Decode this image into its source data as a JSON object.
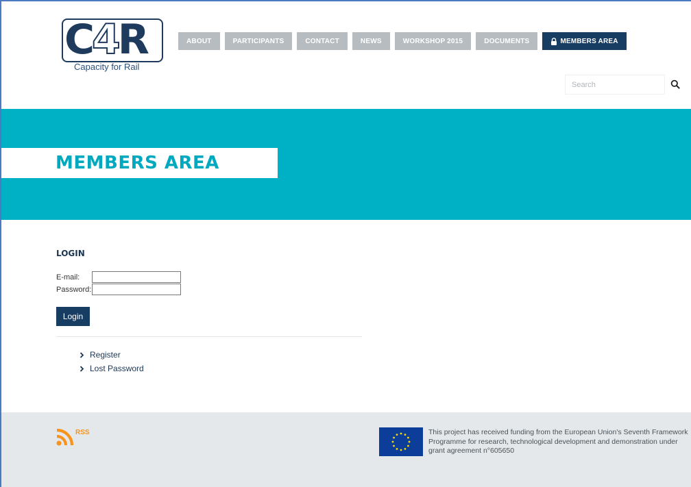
{
  "header": {
    "logo": {
      "letters": {
        "c": "C",
        "four": "4",
        "r": "R"
      },
      "tagline": "Capacity for Rail"
    },
    "nav": [
      {
        "label": "ABOUT"
      },
      {
        "label": "PARTICIPANTS"
      },
      {
        "label": "CONTACT"
      },
      {
        "label": "NEWS"
      },
      {
        "label": "WORKSHOP 2015"
      },
      {
        "label": "DOCUMENTS"
      },
      {
        "label": "MEMBERS AREA",
        "icon": "lock-icon",
        "active": true
      }
    ],
    "search": {
      "placeholder": "Search",
      "value": "",
      "icon": "search-icon"
    }
  },
  "banner": {
    "title": "MEMBERS AREA"
  },
  "login": {
    "title": "LOGIN",
    "email_label": "E-mail:",
    "email_value": "",
    "password_label": "Password:",
    "password_value": "",
    "button_label": "Login",
    "links": [
      {
        "label": "Register",
        "icon": "chevron-right-icon"
      },
      {
        "label": "Lost Password",
        "icon": "chevron-right-icon"
      }
    ]
  },
  "footer": {
    "rss_label": "RSS",
    "rss_icon": "rss-icon",
    "flag_icon": "eu-flag-icon",
    "funding_text": "This project has received funding from the European Union's Seventh Framework Programme for research, technological development and demonstration under grant agreement n°605650"
  },
  "colors": {
    "accent": "#00b0c4",
    "navy": "#173d63",
    "nav_inactive": "#b7bcc0",
    "footer_bg": "#e4e8ea",
    "rss": "#f7941d",
    "eu_blue": "#0b3d99",
    "eu_stars": "#ffdd00"
  }
}
